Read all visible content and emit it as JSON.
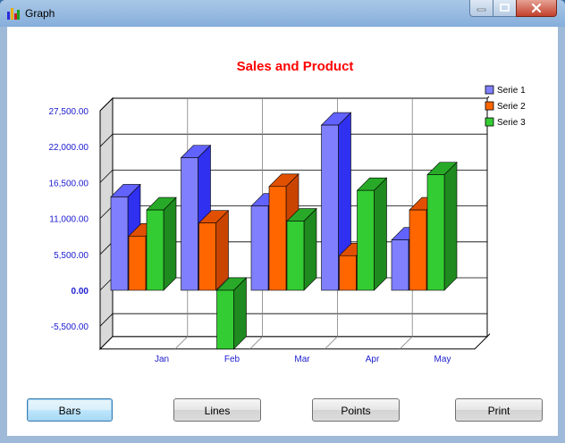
{
  "window": {
    "title": "Graph",
    "icon": "bar-chart-app-icon"
  },
  "buttons": {
    "bars": "Bars",
    "lines": "Lines",
    "points": "Points",
    "print": "Print"
  },
  "colors": {
    "title": "#ff0000",
    "tick_text": "#1a1ad0",
    "serie1": "#8080ff",
    "serie2": "#ff6600",
    "serie3": "#33cc33"
  },
  "chart_data": {
    "type": "bar",
    "title": "Sales and Product",
    "categories": [
      "Jan",
      "Feb",
      "Mar",
      "Apr",
      "May"
    ],
    "series": [
      {
        "name": "Serie 1",
        "values": [
          14300,
          20300,
          12900,
          25300,
          7700
        ]
      },
      {
        "name": "Serie 2",
        "values": [
          8300,
          10300,
          15900,
          5300,
          12300
        ]
      },
      {
        "name": "Serie 3",
        "values": [
          12300,
          -9000,
          10600,
          15300,
          17700
        ]
      }
    ],
    "yticks": [
      "27,500.00",
      "22,000.00",
      "16,500.00",
      "11,000.00",
      "5,500.00",
      "0.00",
      "-5,500.00"
    ],
    "ylim": [
      -9000,
      27500
    ],
    "grid": true,
    "legend": "right"
  }
}
